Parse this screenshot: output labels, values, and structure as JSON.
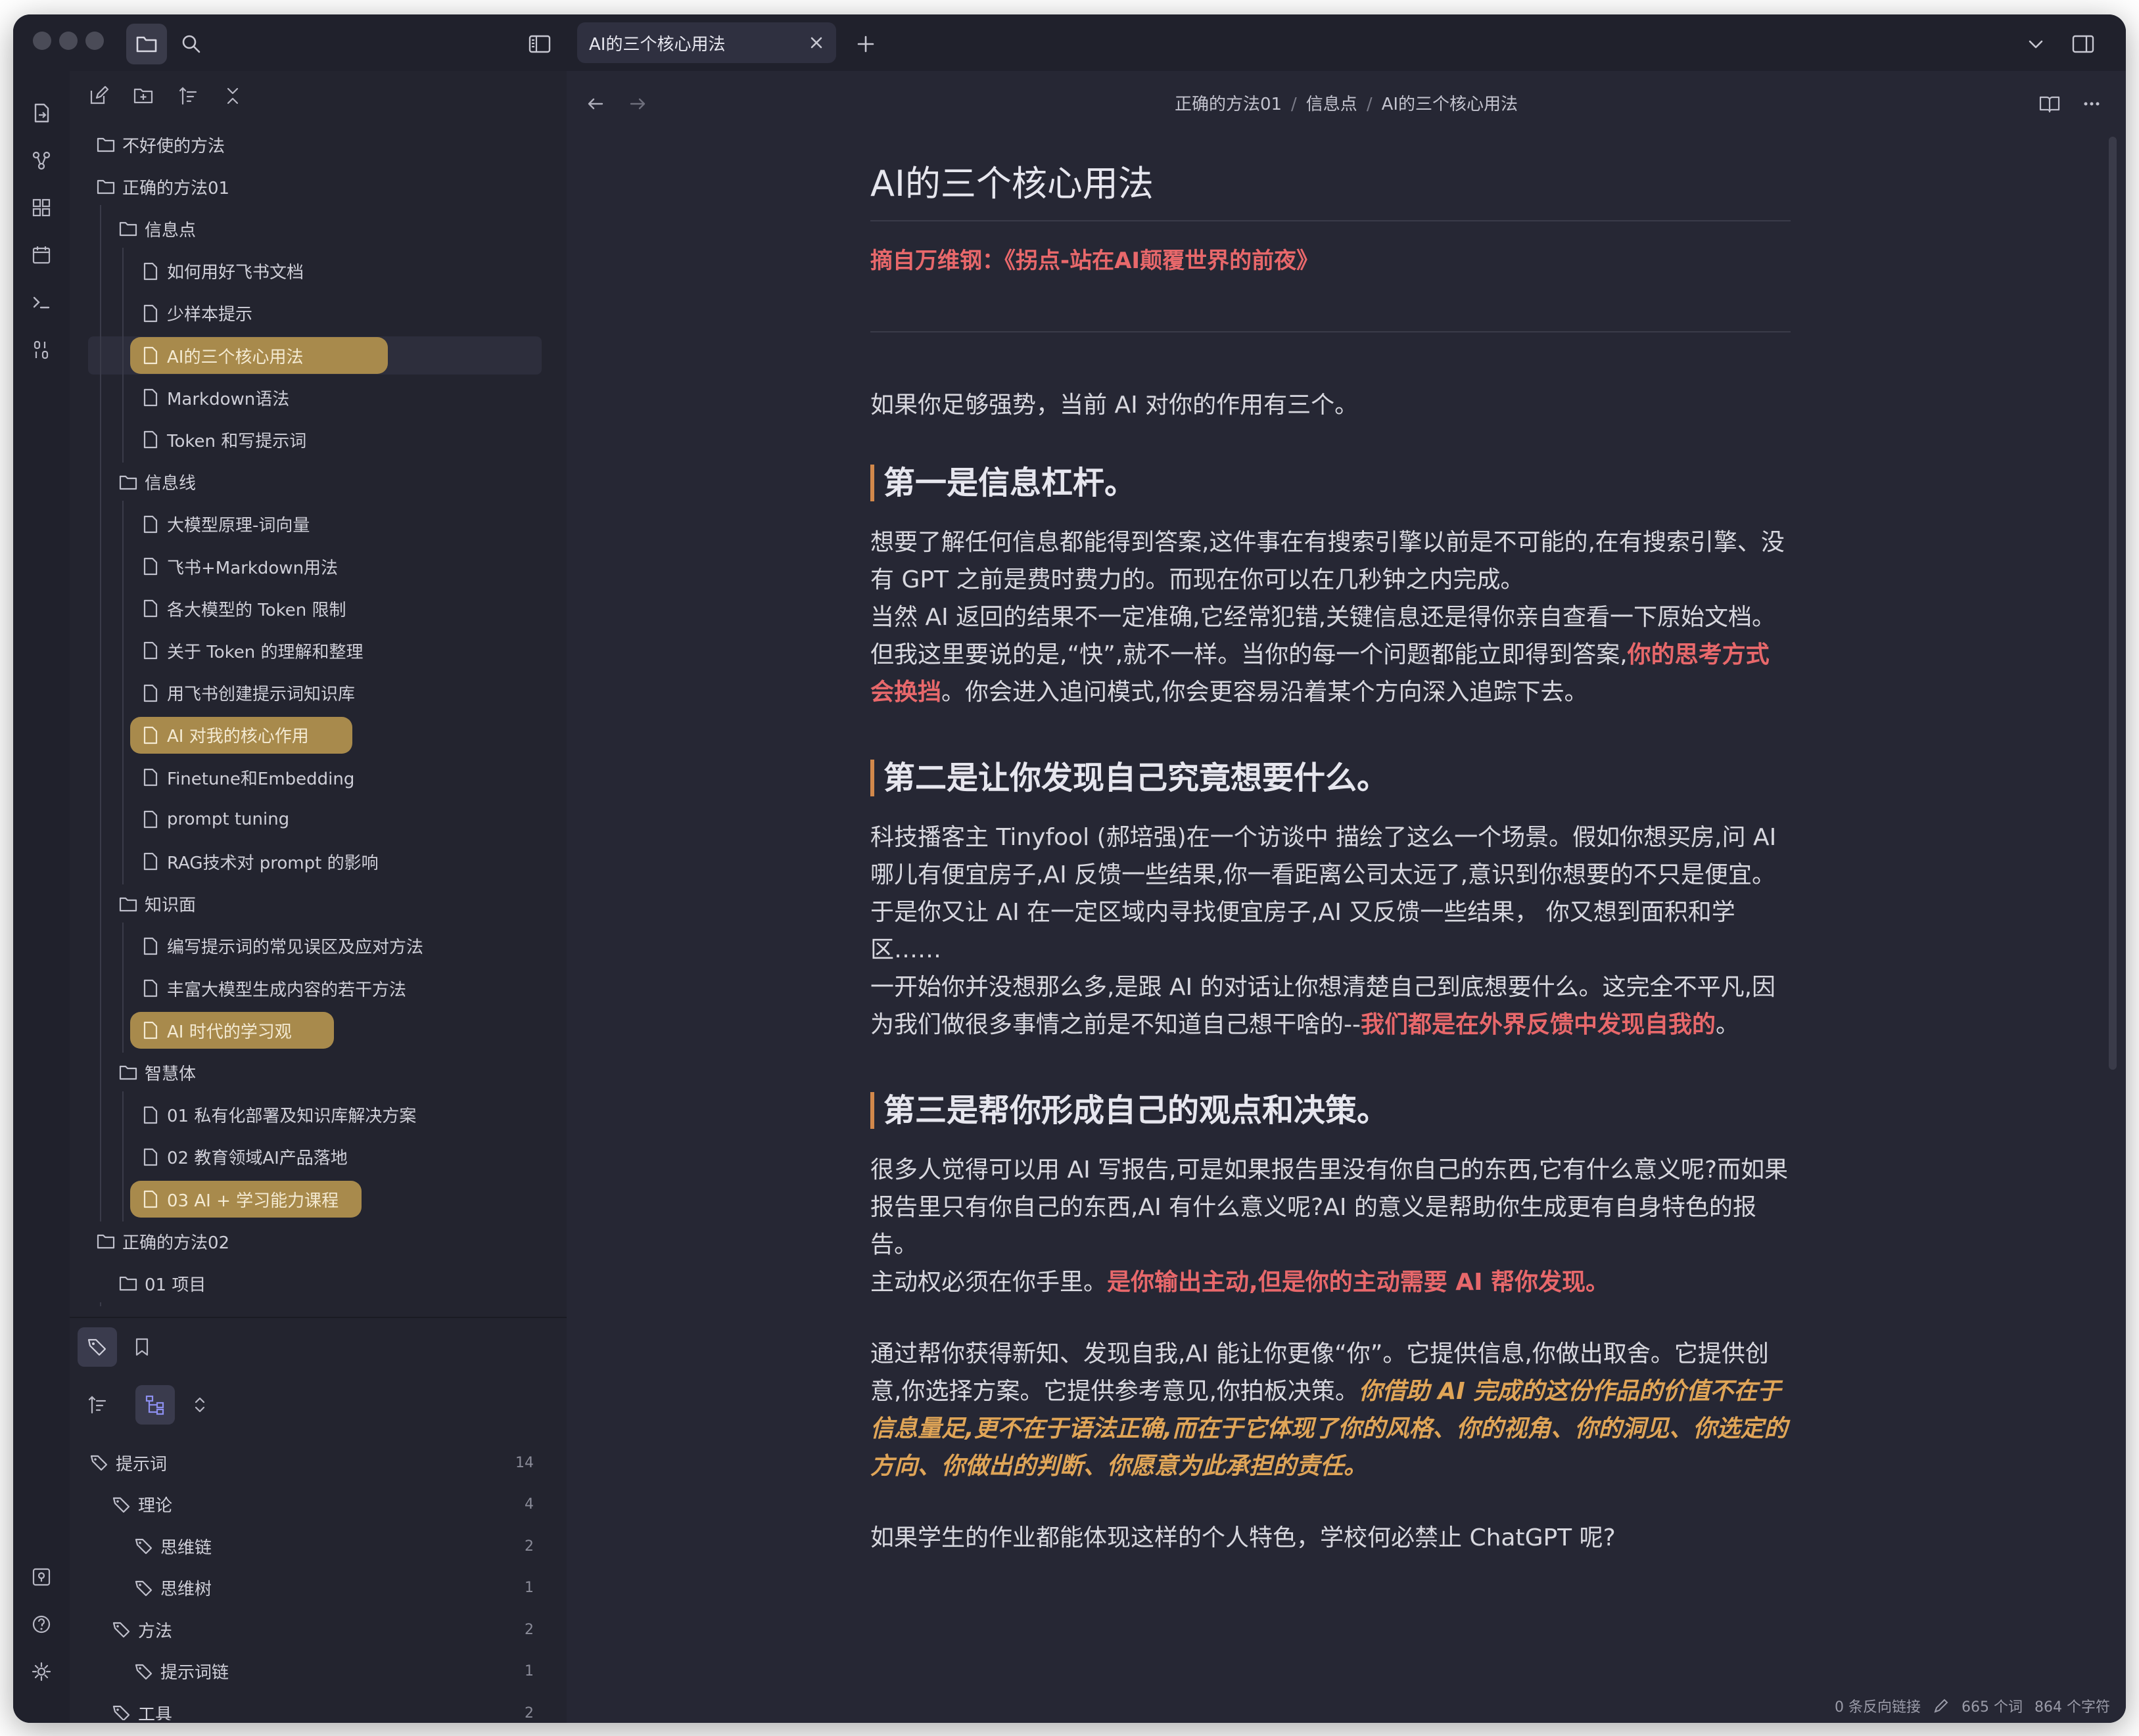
{
  "app": {
    "active_tab": "AI的三个核心用法"
  },
  "sidebar": {
    "tree": [
      {
        "label": "不好使的方法",
        "type": "folder",
        "depth": 0
      },
      {
        "label": "正确的方法01",
        "type": "folder",
        "depth": 0
      },
      {
        "label": "信息点",
        "type": "folder",
        "depth": 1
      },
      {
        "label": "如何用好飞书文档",
        "type": "file",
        "depth": 2
      },
      {
        "label": "少样本提示",
        "type": "file",
        "depth": 2
      },
      {
        "label": "AI的三个核心用法",
        "type": "file",
        "depth": 2,
        "highlight": true,
        "selected": true
      },
      {
        "label": "Markdown语法",
        "type": "file",
        "depth": 2
      },
      {
        "label": "Token 和写提示词",
        "type": "file",
        "depth": 2
      },
      {
        "label": "信息线",
        "type": "folder",
        "depth": 1
      },
      {
        "label": "大模型原理-词向量",
        "type": "file",
        "depth": 2
      },
      {
        "label": "飞书+Markdown用法",
        "type": "file",
        "depth": 2
      },
      {
        "label": "各大模型的 Token 限制",
        "type": "file",
        "depth": 2
      },
      {
        "label": "关于 Token 的理解和整理",
        "type": "file",
        "depth": 2
      },
      {
        "label": "用飞书创建提示词知识库",
        "type": "file",
        "depth": 2
      },
      {
        "label": "AI 对我的核心作用",
        "type": "file",
        "depth": 2,
        "highlight": true
      },
      {
        "label": "Finetune和Embedding",
        "type": "file",
        "depth": 2
      },
      {
        "label": "prompt tuning",
        "type": "file",
        "depth": 2
      },
      {
        "label": "RAG技术对 prompt 的影响",
        "type": "file",
        "depth": 2
      },
      {
        "label": "知识面",
        "type": "folder",
        "depth": 1
      },
      {
        "label": "编写提示词的常见误区及应对方法",
        "type": "file",
        "depth": 2
      },
      {
        "label": "丰富大模型生成内容的若干方法",
        "type": "file",
        "depth": 2
      },
      {
        "label": "AI 时代的学习观",
        "type": "file",
        "depth": 2,
        "highlight": true
      },
      {
        "label": "智慧体",
        "type": "folder",
        "depth": 1
      },
      {
        "label": "01 私有化部署及知识库解决方案",
        "type": "file",
        "depth": 2
      },
      {
        "label": "02 教育领域AI产品落地",
        "type": "file",
        "depth": 2
      },
      {
        "label": "03 AI + 学习能力课程",
        "type": "file",
        "depth": 2,
        "highlight": true
      },
      {
        "label": "正确的方法02",
        "type": "folder",
        "depth": 0
      },
      {
        "label": "01 项目",
        "type": "folder",
        "depth": 1
      }
    ],
    "tags": [
      {
        "label": "提示词",
        "count": "14",
        "depth": 0
      },
      {
        "label": "理论",
        "count": "4",
        "depth": 1
      },
      {
        "label": "思维链",
        "count": "2",
        "depth": 2
      },
      {
        "label": "思维树",
        "count": "1",
        "depth": 2
      },
      {
        "label": "方法",
        "count": "2",
        "depth": 1
      },
      {
        "label": "提示词链",
        "count": "1",
        "depth": 2
      },
      {
        "label": "工具",
        "count": "2",
        "depth": 1
      }
    ]
  },
  "breadcrumb": [
    "正确的方法01",
    "信息点",
    "AI的三个核心用法"
  ],
  "note": {
    "title": "AI的三个核心用法",
    "quote": "摘自万维钢：《拐点-站在AI颠覆世界的前夜》",
    "intro": "如果你足够强势，当前 AI 对你的作用有三个。",
    "h1": "第一是信息杠杆。",
    "p1a": "想要了解任何信息都能得到答案,这件事在有搜索引擎以前是不可能的,在有搜索引擎、没有 GPT 之前是费时费力的。而现在你可以在几秒钟之内完成。",
    "p1b": "当然 AI 返回的结果不一定准确,它经常犯错,关键信息还是得你亲自查看一下原始文档。但我这里要说的是,“快”,就不一样。当你的每一个问题都能立即得到答案,",
    "p1b_red": "你的思考方式会换挡",
    "p1b_end": "。你会进入追问模式,你会更容易沿着某个方向深入追踪下去。",
    "h2": "第二是让你发现自己究竟想要什么。",
    "p2a": "科技播客主 Tinyfool (郝培强)在一个访谈中 描绘了这么一个场景。假如你想买房,问 AI 哪儿有便宜房子,AI 反馈一些结果,你一看距离公司太远了,意识到你想要的不只是便宜。于是你又让 AI 在一定区域内寻找便宜房子,AI 又反馈一些结果， 你又想到面积和学区……",
    "p2b": "一开始你并没想那么多,是跟 AI 的对话让你想清楚自己到底想要什么。这完全不平凡,因为我们做很多事情之前是不知道自己想干啥的--",
    "p2b_red": "我们都是在外界反馈中发现自我的",
    "p2b_end": "。",
    "h3": "第三是帮你形成自己的观点和决策。",
    "p3a": "很多人觉得可以用 AI 写报告,可是如果报告里没有你自己的东西,它有什么意义呢?而如果报告里只有你自己的东西,AI 有什么意义呢?AI 的意义是帮助你生成更有自身特色的报告。",
    "p3b": "主动权必须在你手里。",
    "p3b_red": "是你输出主动,但是你的主动需要 AI 帮你发现。",
    "p4": "通过帮你获得新知、发现自我,AI 能让你更像“你”。它提供信息,你做出取舍。它提供创意,你选择方案。它提供参考意见,你拍板决策。",
    "p4_orange": "你借助 AI 完成的这份作品的价值不在于信息量足,更不在于语法正确,而在于它体现了你的风格、你的视角、你的洞见、你选定的方向、你做出的判断、你愿意为此承担的责任。",
    "p5": "如果学生的作业都能体现这样的个人特色，学校何必禁止 ChatGPT 呢?"
  },
  "status": {
    "backlinks": "0 条反向链接",
    "words": "665 个词",
    "chars": "864 个字符"
  },
  "colors": {
    "accent_red": "#e8686b",
    "accent_orange": "#e0a557",
    "highlight": "#a88a4c",
    "background": "#262734"
  }
}
